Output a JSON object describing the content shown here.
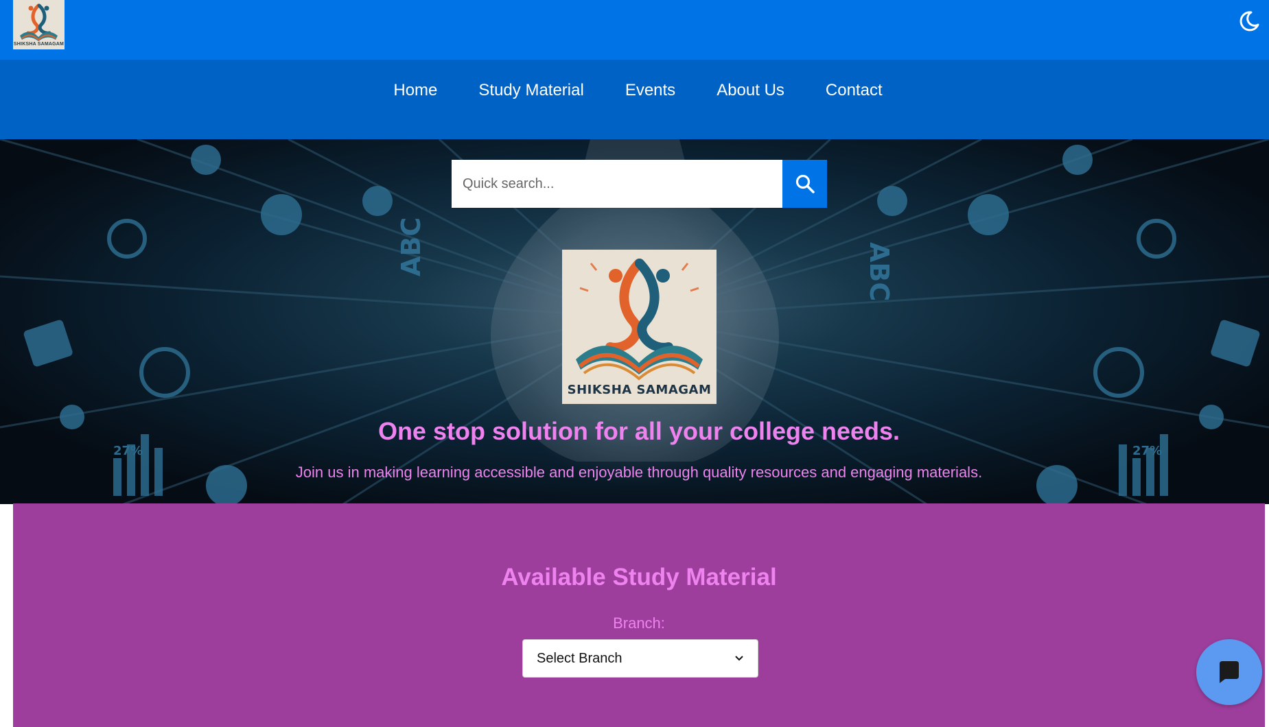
{
  "header": {
    "logo_text": "SHIKSHA SAMAGAM",
    "theme_icon": "moon-icon"
  },
  "nav": {
    "items": [
      {
        "label": "Home"
      },
      {
        "label": "Study Material"
      },
      {
        "label": "Events"
      },
      {
        "label": "About Us"
      },
      {
        "label": "Contact"
      }
    ]
  },
  "search": {
    "placeholder": "Quick search...",
    "icon": "search-icon"
  },
  "hero": {
    "logo_text": "SHIKSHA  SAMAGAM",
    "background_labels": [
      "ABC",
      "ABC",
      "27%",
      "27%"
    ],
    "tagline": "One stop solution for all your college needs.",
    "subtagline": "Join us in making learning accessible and enjoyable through quality resources and engaging materials."
  },
  "study": {
    "title": "Available Study Material",
    "branch_label": "Branch:",
    "branch_selected": "Select Branch"
  },
  "chat": {
    "icon": "chat-bubble-icon"
  },
  "colors": {
    "topbar": "#0073e6",
    "navbar": "#0062c4",
    "accent_text": "#ee82ee",
    "section_bg": "#9d3e9d",
    "chat_button": "#5b9af0"
  }
}
